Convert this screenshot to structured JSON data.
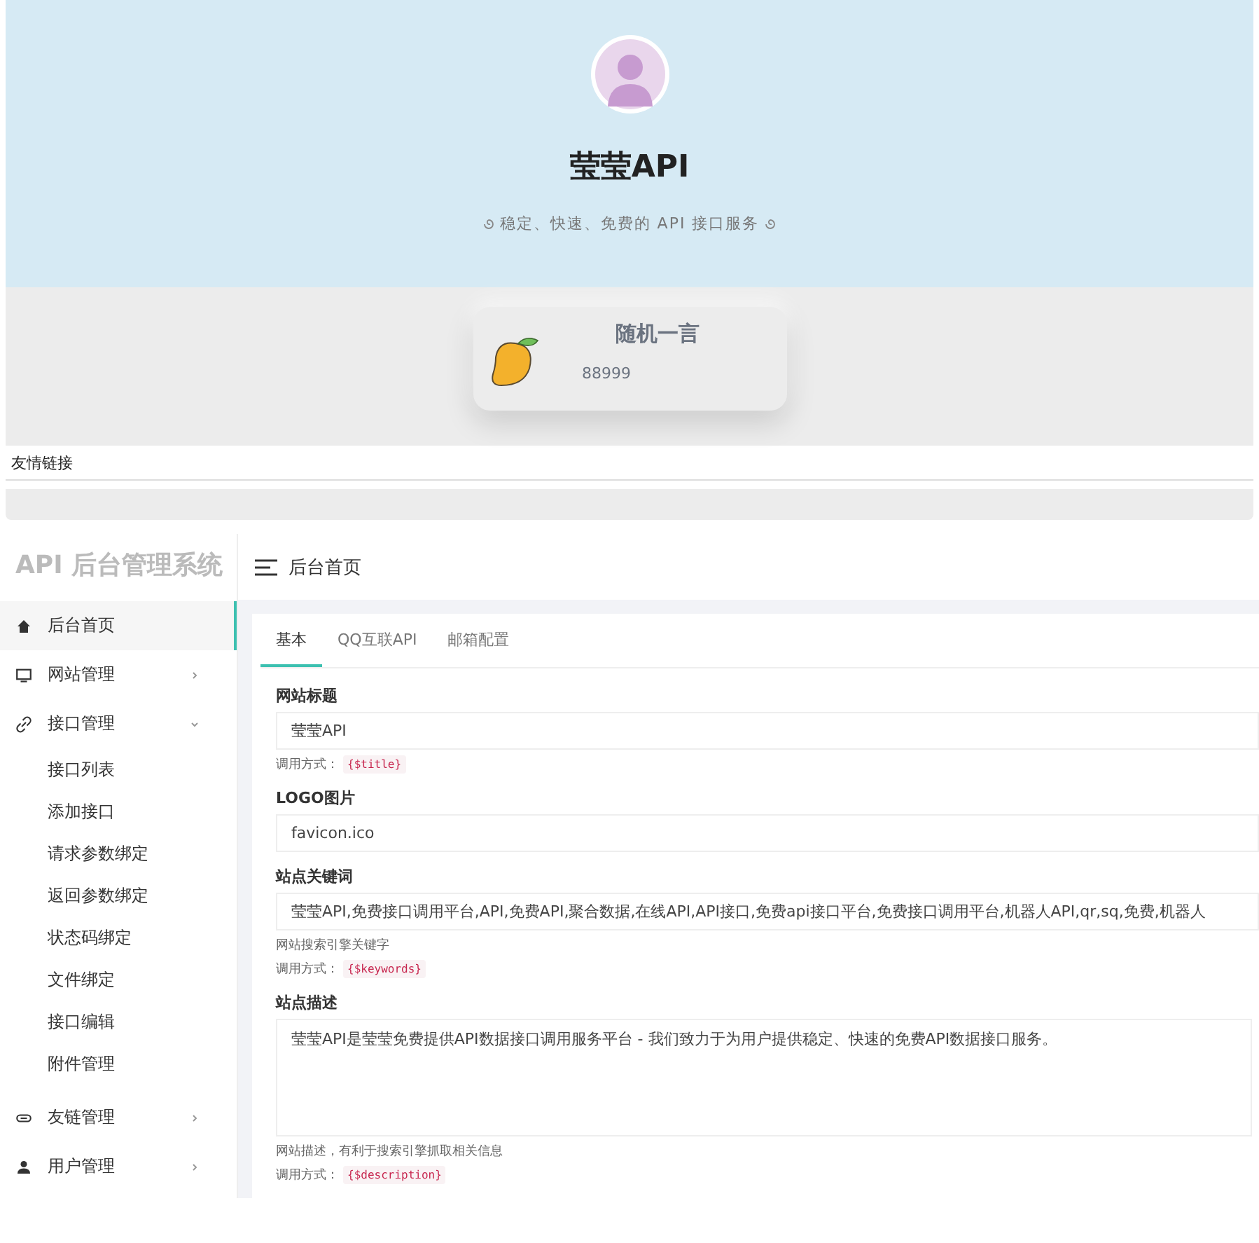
{
  "hero": {
    "title": "莹莹API",
    "subtitle": "稳定、快速、免费的 API 接口服务"
  },
  "quote_card": {
    "title": "随机一言",
    "text": "88999"
  },
  "links_bar": {
    "label": "友情链接"
  },
  "admin": {
    "brand": "API 后台管理系统",
    "header_title": "后台首页",
    "menu": [
      {
        "kind": "link",
        "label": "后台首页",
        "selected": true
      },
      {
        "kind": "group",
        "label": "网站管理",
        "selected": false,
        "expanded": false
      },
      {
        "kind": "group",
        "label": "接口管理",
        "selected": false,
        "expanded": true,
        "children": [
          {
            "label": "接口列表",
            "selected": false
          },
          {
            "label": "添加接口",
            "selected": false
          },
          {
            "label": "请求参数绑定",
            "selected": false
          },
          {
            "label": "返回参数绑定",
            "selected": false
          },
          {
            "label": "状态码绑定",
            "selected": false
          },
          {
            "label": "文件绑定",
            "selected": false
          },
          {
            "label": "接口编辑",
            "selected": false
          },
          {
            "label": "附件管理",
            "selected": false
          }
        ]
      },
      {
        "kind": "group",
        "label": "友链管理",
        "selected": false,
        "expanded": false
      },
      {
        "kind": "group",
        "label": "用户管理",
        "selected": false,
        "expanded": false
      }
    ],
    "tabs": [
      {
        "label": "基本",
        "selected": true
      },
      {
        "label": "QQ互联API",
        "selected": false
      },
      {
        "label": "邮箱配置",
        "selected": false
      }
    ],
    "fields": [
      {
        "kind": "input",
        "label": "网站标题",
        "value": "莹莹API",
        "usage_label": "调用方式：",
        "usage_code": "{$title}"
      },
      {
        "kind": "input",
        "label": "LOGO图片",
        "value": "favicon.ico"
      },
      {
        "kind": "input",
        "label": "站点关键词",
        "value": "莹莹API,免费接口调用平台,API,免费API,聚合数据,在线API,API接口,免费api接口平台,免费接口调用平台,机器人API,qr,sq,免费,机器人",
        "hint": "网站搜索引擎关键字",
        "usage_label": "调用方式：",
        "usage_code": "{$keywords}"
      },
      {
        "kind": "textarea",
        "label": "站点描述",
        "value": "莹莹API是莹莹免费提供API数据接口调用服务平台 - 我们致力于为用户提供稳定、快速的免费API数据接口服务。",
        "hint": "网站描述，有利于搜索引擎抓取相关信息",
        "usage_label": "调用方式：",
        "usage_code": "{$description}"
      }
    ]
  }
}
